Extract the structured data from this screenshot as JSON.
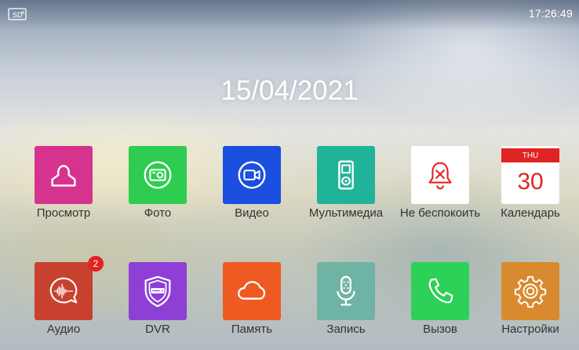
{
  "status_bar": {
    "sd_icon": "sd-card-icon",
    "time": "17:26:49"
  },
  "date": "15/04/2021",
  "apps_row1": [
    {
      "label": "Просмотр",
      "icon": "person-icon",
      "color": "#d6338e"
    },
    {
      "label": "Фото",
      "icon": "photo-camera-icon",
      "color": "#2ecc50"
    },
    {
      "label": "Видео",
      "icon": "video-camera-icon",
      "color": "#1a4fe0"
    },
    {
      "label": "Мультимедиа",
      "icon": "media-player-icon",
      "color": "#21b39a"
    },
    {
      "label": "Не беспокоить",
      "icon": "bell-off-icon",
      "color": "#ffffff"
    },
    {
      "label": "Календарь",
      "icon": "calendar-icon",
      "color": "#ffffff",
      "weekday": "THU",
      "day": "30"
    }
  ],
  "apps_row2": [
    {
      "label": "Аудио",
      "icon": "audio-wave-icon",
      "color": "#c8412f",
      "badge": "2"
    },
    {
      "label": "DVR",
      "icon": "shield-icon",
      "color": "#8e3fd6"
    },
    {
      "label": "Память",
      "icon": "cloud-icon",
      "color": "#ee5a22"
    },
    {
      "label": "Запись",
      "icon": "microphone-icon",
      "color": "#6fb3a4"
    },
    {
      "label": "Вызов",
      "icon": "phone-icon",
      "color": "#2ed158"
    },
    {
      "label": "Настройки",
      "icon": "gear-icon",
      "color": "#d98a2e"
    }
  ]
}
